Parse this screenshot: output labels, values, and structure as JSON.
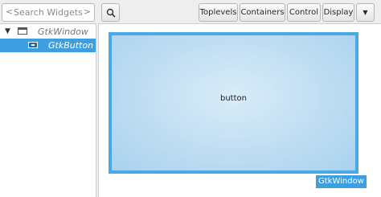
{
  "search": {
    "placeholder": "Search Widgets",
    "left_chevron": "<",
    "right_chevron": ">"
  },
  "tree": {
    "items": [
      {
        "label": "GtkWindow",
        "icon": "window-icon",
        "expanded": true,
        "selected": false
      },
      {
        "label": "GtkButton",
        "icon": "button-widget-icon",
        "selected": true
      }
    ],
    "expander_glyph": "▼"
  },
  "toolbar": {
    "search_icon": "search-icon",
    "buttons": [
      "Toplevels",
      "Containers",
      "Control",
      "Display"
    ],
    "dropdown_glyph": "▼"
  },
  "canvas": {
    "button_label": "button",
    "window_tag": "GtkWindow",
    "colors": {
      "selection": "#3d9ee0",
      "window_border": "#4aa9e3",
      "window_fill": "#bcdcf2"
    }
  }
}
